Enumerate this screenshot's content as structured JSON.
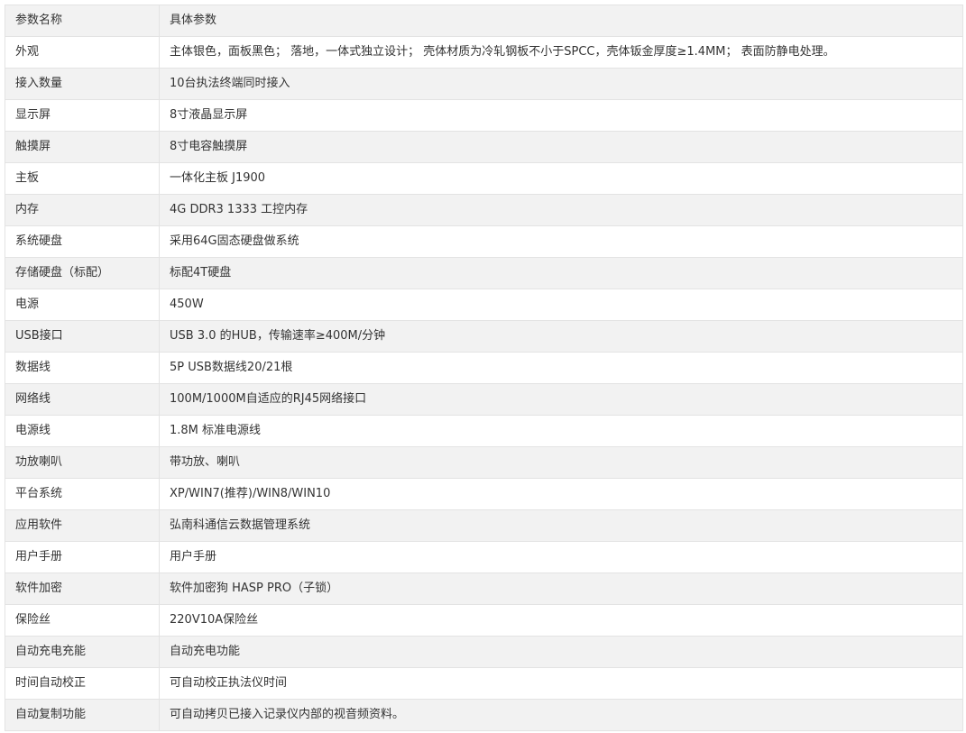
{
  "table": {
    "header": {
      "name": "参数名称",
      "value": "具体参数"
    },
    "rows": [
      {
        "name": "外观",
        "value": "主体银色，面板黑色； 落地，一体式独立设计； 壳体材质为冷轧钢板不小于SPCC，壳体钣金厚度≥1.4MM； 表面防静电处理。"
      },
      {
        "name": "接入数量",
        "value": "10台执法终端同时接入"
      },
      {
        "name": "显示屏",
        "value": "8寸液晶显示屏"
      },
      {
        "name": "触摸屏",
        "value": "8寸电容触摸屏"
      },
      {
        "name": "主板",
        "value": "一体化主板 J1900"
      },
      {
        "name": "内存",
        "value": "4G DDR3 1333 工控内存"
      },
      {
        "name": "系统硬盘",
        "value": "采用64G固态硬盘做系统"
      },
      {
        "name": "存储硬盘（标配）",
        "value": "标配4T硬盘"
      },
      {
        "name": "电源",
        "value": "450W"
      },
      {
        "name": "USB接口",
        "value": "USB 3.0 的HUB，传输速率≥400M/分钟"
      },
      {
        "name": "数据线",
        "value": "5P USB数据线20/21根"
      },
      {
        "name": "网络线",
        "value": "100M/1000M自适应的RJ45网络接口"
      },
      {
        "name": "电源线",
        "value": "1.8M 标准电源线"
      },
      {
        "name": "功放喇叭",
        "value": "带功放、喇叭"
      },
      {
        "name": "平台系统",
        "value": "XP/WIN7(推荐)/WIN8/WIN10"
      },
      {
        "name": "应用软件",
        "value": "弘南科通信云数据管理系统"
      },
      {
        "name": "用户手册",
        "value": "用户手册"
      },
      {
        "name": "软件加密",
        "value": "软件加密狗 HASP PRO（子锁）"
      },
      {
        "name": "保险丝",
        "value": "220V10A保险丝"
      },
      {
        "name": "自动充电充能",
        "value": "自动充电功能"
      },
      {
        "name": "时间自动校正",
        "value": "可自动校正执法仪时间"
      },
      {
        "name": "自动复制功能",
        "value": "可自动拷贝已接入记录仪内部的视音频资料。"
      }
    ]
  }
}
